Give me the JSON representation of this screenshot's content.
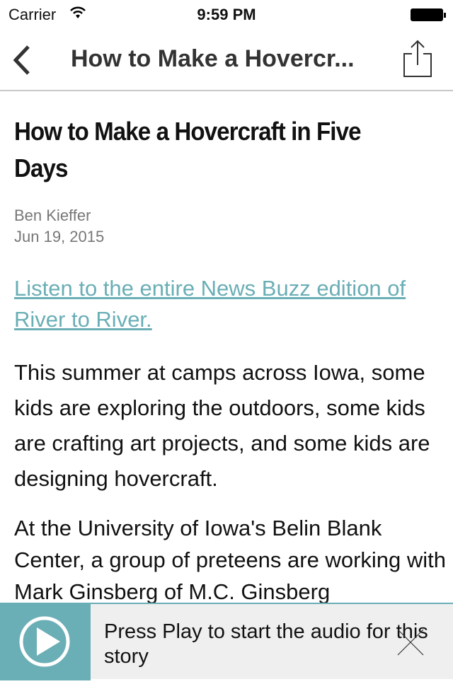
{
  "status_bar": {
    "carrier": "Carrier",
    "time": "9:59 PM",
    "wifi_icon": "wifi-icon",
    "battery_icon": "battery-icon"
  },
  "nav": {
    "title": "How to Make a Hovercr...",
    "back_icon": "chevron-left-icon",
    "share_icon": "share-icon"
  },
  "article": {
    "title": "How to Make a Hovercraft in Five Days",
    "author": "Ben Kieffer",
    "date": "Jun 19, 2015",
    "link": "Listen to the entire News Buzz edition of River to River.",
    "paragraphs": [
      "This summer at camps across Iowa, some kids are exploring the outdoors, some kids are crafting art projects, and some kids are designing hovercraft.",
      "At the University of Iowa's Belin Blank Center, a group of preteens are working with Mark Ginsberg of M.C. Ginsberg"
    ]
  },
  "player": {
    "message": "Press Play to start the audio for this story",
    "play_icon": "play-icon",
    "close_icon": "close-icon"
  },
  "colors": {
    "accent": "#6aaeb6",
    "player_bg": "#efefef"
  }
}
